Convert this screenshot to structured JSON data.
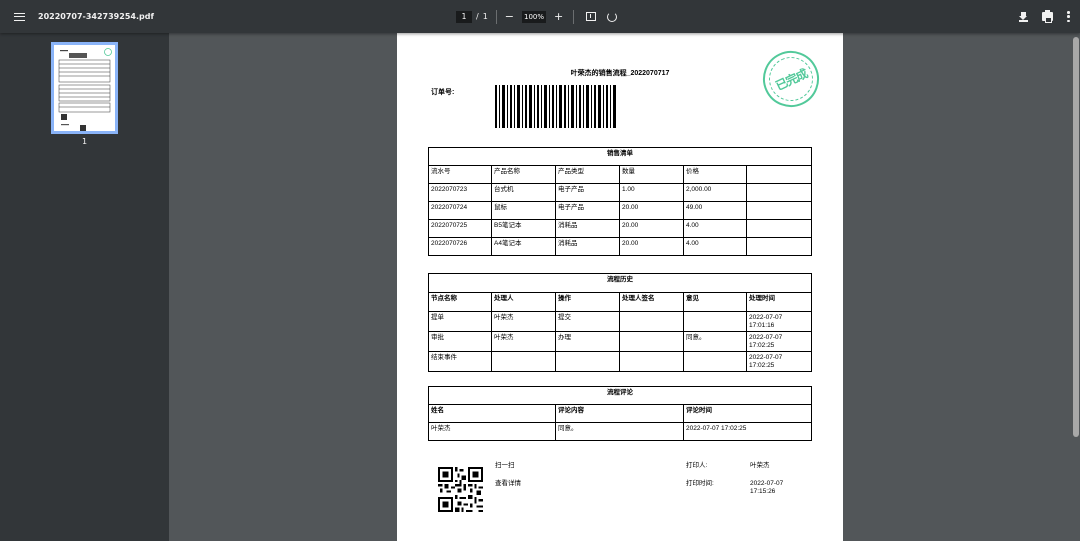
{
  "toolbar": {
    "file_name": "20220707-342739254.pdf",
    "page_current": "1",
    "page_separator": "/",
    "page_total": "1",
    "zoom_out": "−",
    "zoom": "100%",
    "zoom_in": "+"
  },
  "sidebar": {
    "thumb_page_number": "1"
  },
  "document": {
    "title": "叶荣杰的销售流程_2022070717",
    "order_label": "订单号:",
    "stamp_text": "已完成",
    "sales": {
      "caption": "销售清单",
      "headers": [
        "流水号",
        "产品名称",
        "产品类型",
        "数量",
        "价格",
        ""
      ],
      "rows": [
        [
          "2022070723",
          "台式机",
          "电子产品",
          "1.00",
          "2,000.00",
          ""
        ],
        [
          "2022070724",
          "鼠标",
          "电子产品",
          "20.00",
          "49.00",
          ""
        ],
        [
          "2022070725",
          "B5笔记本",
          "消耗品",
          "20.00",
          "4.00",
          ""
        ],
        [
          "2022070726",
          "A4笔记本",
          "消耗品",
          "20.00",
          "4.00",
          ""
        ]
      ]
    },
    "flow_history": {
      "caption": "流程历史",
      "headers": [
        "节点名称",
        "处理人",
        "操作",
        "处理人签名",
        "意见",
        "处理时间"
      ],
      "rows": [
        [
          "提单",
          "叶荣杰",
          "提交",
          "",
          "",
          "2022-07-07 17:01:16"
        ],
        [
          "审批",
          "叶荣杰",
          "办理",
          "",
          "同意。",
          "2022-07-07 17:02:25"
        ],
        [
          "结束事件",
          "",
          "",
          "",
          "",
          "2022-07-07 17:02:25"
        ]
      ]
    },
    "flow_comments": {
      "caption": "流程评论",
      "headers": [
        "姓名",
        "评论内容",
        "评论时间"
      ],
      "rows": [
        [
          "叶荣杰",
          "同意。",
          "2022-07-07 17:02:25"
        ]
      ]
    },
    "footer": {
      "scan_label": "扫一扫",
      "view_details": "查看详情",
      "printer_label": "打印人:",
      "printer_value": "叶荣杰",
      "print_time_label": "打印时间:",
      "print_time_value": "2022-07-07 17:15:26"
    }
  },
  "colors": {
    "toolbar_bg": "#323639",
    "viewer_bg": "#525659",
    "thumb_border": "#8ab4f8",
    "stamp": "#52c99a"
  }
}
